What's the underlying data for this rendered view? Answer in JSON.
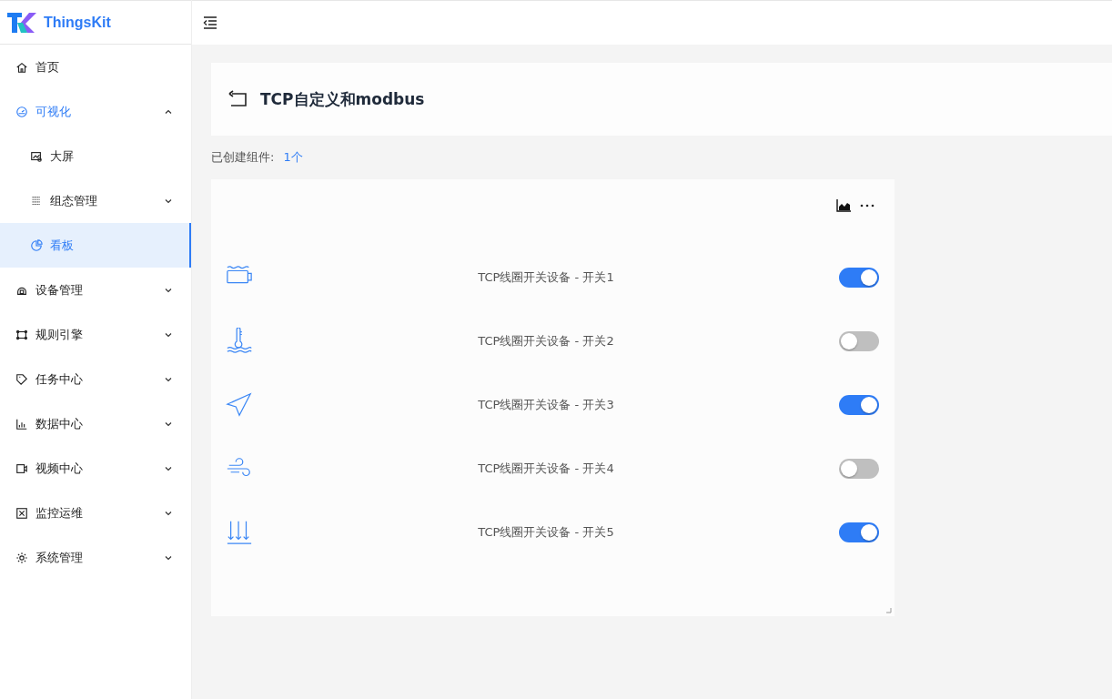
{
  "app": {
    "name": "ThingsKit"
  },
  "sidebar": {
    "items": [
      {
        "label": "首页",
        "kind": "leaf",
        "selected": false
      },
      {
        "label": "可视化",
        "kind": "group",
        "expanded": true,
        "selected": false,
        "children": [
          {
            "label": "大屏",
            "kind": "leaf",
            "selected": false
          },
          {
            "label": "组态管理",
            "kind": "group",
            "expanded": false,
            "selected": false
          },
          {
            "label": "看板",
            "kind": "leaf",
            "selected": true
          }
        ]
      },
      {
        "label": "设备管理",
        "kind": "group",
        "expanded": false,
        "selected": false
      },
      {
        "label": "规则引擎",
        "kind": "group",
        "expanded": false,
        "selected": false
      },
      {
        "label": "任务中心",
        "kind": "group",
        "expanded": false,
        "selected": false
      },
      {
        "label": "数据中心",
        "kind": "group",
        "expanded": false,
        "selected": false
      },
      {
        "label": "视频中心",
        "kind": "group",
        "expanded": false,
        "selected": false
      },
      {
        "label": "监控运维",
        "kind": "group",
        "expanded": false,
        "selected": false
      },
      {
        "label": "系统管理",
        "kind": "group",
        "expanded": false,
        "selected": false
      }
    ]
  },
  "page": {
    "title": "TCP自定义和modbus",
    "count_label": "已创建组件:",
    "count_value": "1个"
  },
  "widget": {
    "switches": [
      {
        "label": "TCP线圈开关设备 - 开关1",
        "on": true
      },
      {
        "label": "TCP线圈开关设备 - 开关2",
        "on": false
      },
      {
        "label": "TCP线圈开关设备 - 开关3",
        "on": true
      },
      {
        "label": "TCP线圈开关设备 - 开关4",
        "on": false
      },
      {
        "label": "TCP线圈开关设备 - 开关5",
        "on": true
      }
    ]
  }
}
